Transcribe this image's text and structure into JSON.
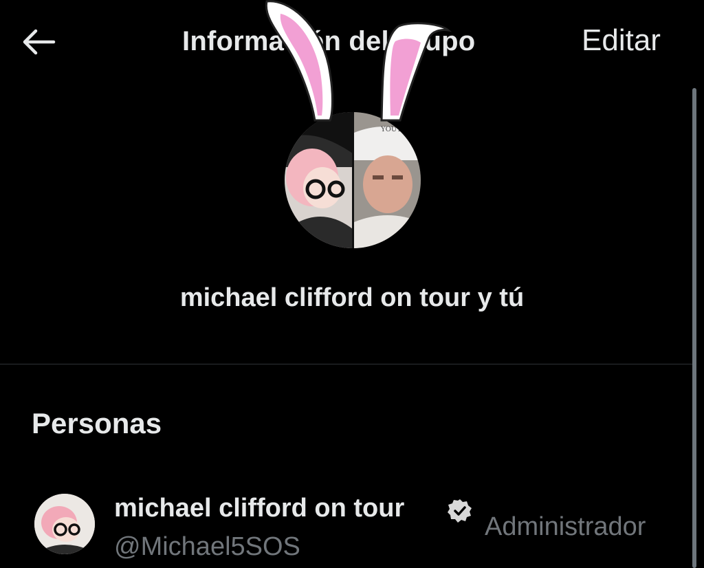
{
  "header": {
    "title": "Información del grupo",
    "edit_label": "Editar",
    "back_icon": "arrow-left-icon"
  },
  "group": {
    "name": "michael clifford on tour y tú"
  },
  "people": {
    "section_title": "Personas",
    "members": [
      {
        "name": "michael clifford on tour",
        "handle": "@Michael5SOS",
        "role": "Administrador",
        "verified": true
      }
    ]
  },
  "colors": {
    "background": "#000000",
    "text_primary": "#e7e9ea",
    "text_secondary": "#71767b",
    "divider": "#2f3336",
    "ear_pink": "#f2a0d4"
  }
}
